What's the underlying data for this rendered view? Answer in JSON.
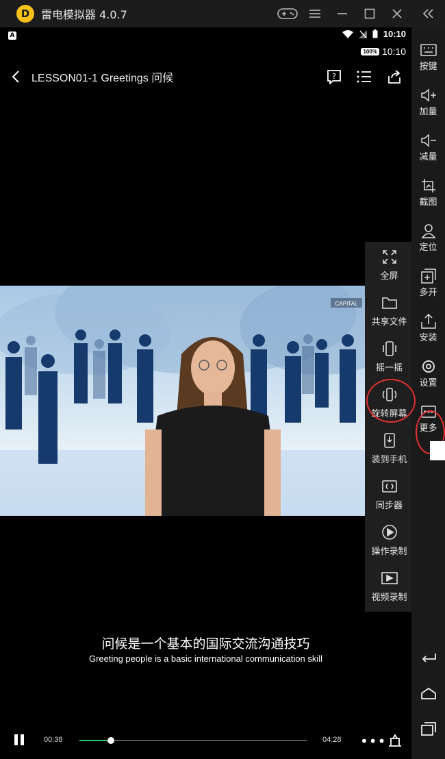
{
  "emulator": {
    "title": "雷电模拟器 4.0.7",
    "logo_letter": "D",
    "window_controls": [
      "gamepad-icon",
      "menu-icon",
      "minimize-icon",
      "maximize-icon",
      "close-icon",
      "collapse-icon"
    ]
  },
  "status": {
    "time_primary": "10:10",
    "time_secondary": "10:10",
    "battery_label": "100%",
    "notification_badge": "A"
  },
  "appbar": {
    "title": "LESSON01-1 Greetings 问候"
  },
  "video": {
    "watermark": "CAPITAL"
  },
  "subtitles": {
    "chinese": "问候是一个基本的国际交流沟通技巧",
    "english": "Greeting people is a basic international communication skill"
  },
  "player": {
    "current_time": "00:38",
    "total_time": "04:28",
    "progress": 0.14,
    "more_label": "•••"
  },
  "more_panel": {
    "items": [
      {
        "label": "全屏",
        "icon": "fullscreen-icon"
      },
      {
        "label": "共享文件",
        "icon": "folder-icon"
      },
      {
        "label": "摇一摇",
        "icon": "shake-icon"
      },
      {
        "label": "旋转屏幕",
        "icon": "rotate-screen-icon"
      },
      {
        "label": "装到手机",
        "icon": "install-to-phone-icon"
      },
      {
        "label": "同步器",
        "icon": "sync-icon"
      },
      {
        "label": "操作录制",
        "icon": "operation-record-icon"
      },
      {
        "label": "视频录制",
        "icon": "video-record-icon"
      }
    ]
  },
  "toolbar": {
    "items": [
      {
        "label": "按键",
        "icon": "keyboard-icon"
      },
      {
        "label": "加量",
        "icon": "volume-up-icon"
      },
      {
        "label": "减量",
        "icon": "volume-down-icon"
      },
      {
        "label": "截图",
        "icon": "screenshot-icon"
      },
      {
        "label": "定位",
        "icon": "location-icon"
      },
      {
        "label": "多开",
        "icon": "multi-instance-icon"
      },
      {
        "label": "安装",
        "icon": "install-icon"
      },
      {
        "label": "设置",
        "icon": "settings-icon"
      },
      {
        "label": "更多",
        "icon": "more-icon"
      }
    ],
    "nav": [
      "back-icon",
      "home-icon",
      "recents-icon"
    ]
  },
  "colors": {
    "accent_progress": "#2ecc71",
    "highlight_circle": "#e53030",
    "logo": "#f7c117"
  }
}
